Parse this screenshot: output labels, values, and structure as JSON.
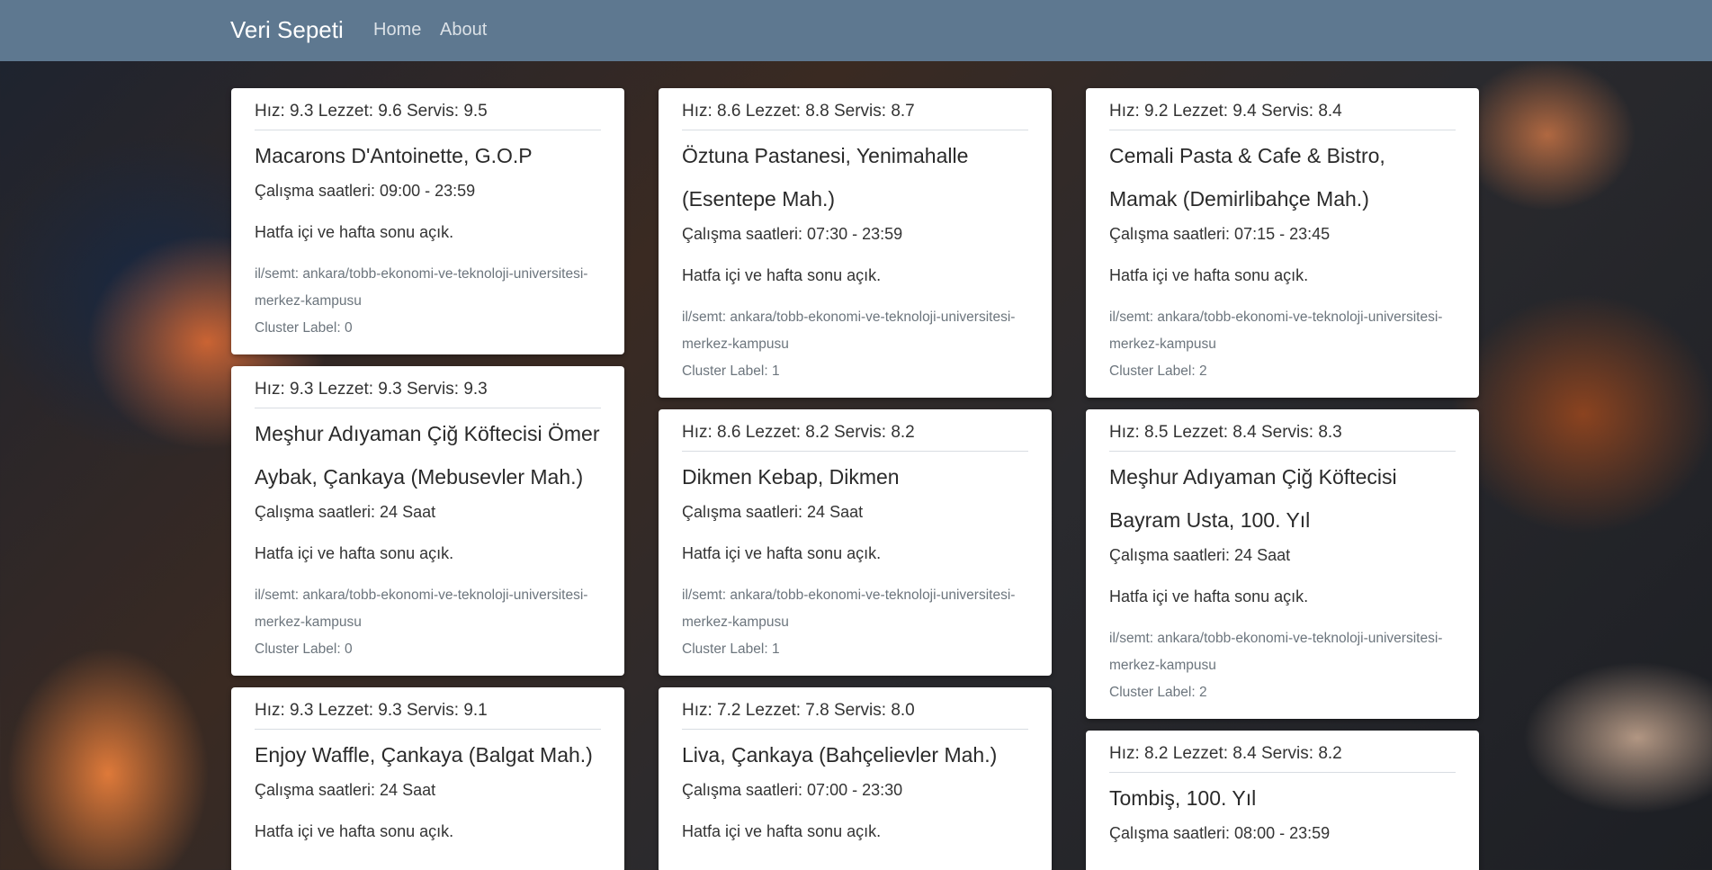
{
  "navbar": {
    "brand": "Veri Sepeti",
    "links": [
      "Home",
      "About"
    ]
  },
  "columns": [
    [
      {
        "scores": "Hız: 9.3 Lezzet: 9.6 Servis: 9.5",
        "name": "Macarons D'Antoinette, G.O.P",
        "hours": "Çalışma saatleri: 09:00 - 23:59",
        "open": "Hatfa içi ve hafta sonu açık.",
        "location": "il/semt: ankara/tobb-ekonomi-ve-teknoloji-universitesi-merkez-kampusu",
        "cluster": "Cluster Label: 0"
      },
      {
        "scores": "Hız: 9.3 Lezzet: 9.3 Servis: 9.3",
        "name": "Meşhur Adıyaman Çiğ Köftecisi Ömer Aybak, Çankaya (Mebusevler Mah.)",
        "hours": "Çalışma saatleri: 24 Saat",
        "open": "Hatfa içi ve hafta sonu açık.",
        "location": "il/semt: ankara/tobb-ekonomi-ve-teknoloji-universitesi-merkez-kampusu",
        "cluster": "Cluster Label: 0"
      },
      {
        "scores": "Hız: 9.3 Lezzet: 9.3 Servis: 9.1",
        "name": "Enjoy Waffle, Çankaya (Balgat Mah.)",
        "hours": "Çalışma saatleri: 24 Saat",
        "open": "Hatfa içi ve hafta sonu açık.",
        "location": "",
        "cluster": ""
      }
    ],
    [
      {
        "scores": "Hız: 8.6 Lezzet: 8.8 Servis: 8.7",
        "name": "Öztuna Pastanesi, Yenimahalle (Esentepe Mah.)",
        "hours": "Çalışma saatleri: 07:30 - 23:59",
        "open": "Hatfa içi ve hafta sonu açık.",
        "location": "il/semt: ankara/tobb-ekonomi-ve-teknoloji-universitesi-merkez-kampusu",
        "cluster": "Cluster Label: 1"
      },
      {
        "scores": "Hız: 8.6 Lezzet: 8.2 Servis: 8.2",
        "name": "Dikmen Kebap, Dikmen",
        "hours": "Çalışma saatleri: 24 Saat",
        "open": "Hatfa içi ve hafta sonu açık.",
        "location": "il/semt: ankara/tobb-ekonomi-ve-teknoloji-universitesi-merkez-kampusu",
        "cluster": "Cluster Label: 1"
      },
      {
        "scores": "Hız: 7.2 Lezzet: 7.8 Servis: 8.0",
        "name": "Liva, Çankaya (Bahçelievler Mah.)",
        "hours": "Çalışma saatleri: 07:00 - 23:30",
        "open": "Hatfa içi ve hafta sonu açık.",
        "location": "",
        "cluster": ""
      }
    ],
    [
      {
        "scores": "Hız: 9.2 Lezzet: 9.4 Servis: 8.4",
        "name": "Cemali Pasta & Cafe & Bistro, Mamak (Demirlibahçe Mah.)",
        "hours": "Çalışma saatleri: 07:15 - 23:45",
        "open": "Hatfa içi ve hafta sonu açık.",
        "location": "il/semt: ankara/tobb-ekonomi-ve-teknoloji-universitesi-merkez-kampusu",
        "cluster": "Cluster Label: 2"
      },
      {
        "scores": "Hız: 8.5 Lezzet: 8.4 Servis: 8.3",
        "name": "Meşhur Adıyaman Çiğ Köftecisi Bayram Usta, 100. Yıl",
        "hours": "Çalışma saatleri: 24 Saat",
        "open": "Hatfa içi ve hafta sonu açık.",
        "location": "il/semt: ankara/tobb-ekonomi-ve-teknoloji-universitesi-merkez-kampusu",
        "cluster": "Cluster Label: 2"
      },
      {
        "scores": "Hız: 8.2 Lezzet: 8.4 Servis: 8.2",
        "name": "Tombiş, 100. Yıl",
        "hours": "Çalışma saatleri: 08:00 - 23:59",
        "open": "",
        "location": "",
        "cluster": ""
      }
    ]
  ]
}
